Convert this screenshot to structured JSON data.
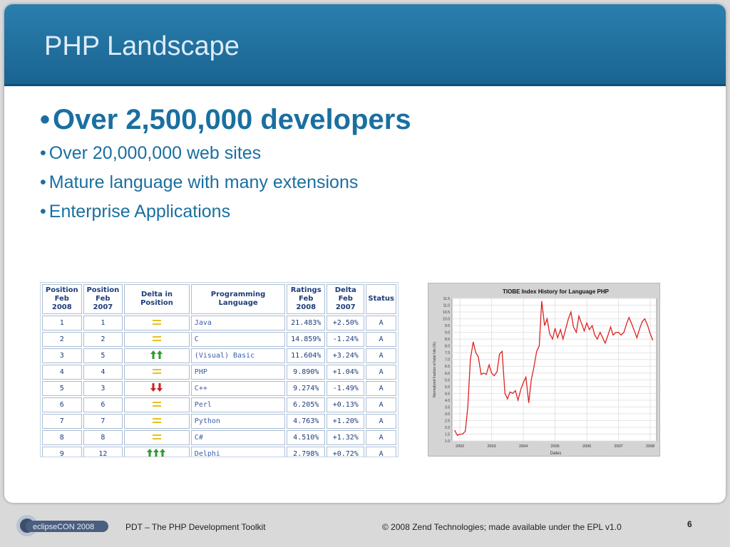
{
  "slide": {
    "title": "PHP Landscape",
    "bullets": [
      {
        "text": "Over 2,500,000 developers"
      },
      {
        "text": "Over 20,000,000 web sites"
      },
      {
        "text": "Mature language with many extensions"
      },
      {
        "text": "Enterprise Applications"
      }
    ]
  },
  "table": {
    "headers": {
      "pos2008": [
        "Position",
        "Feb 2008"
      ],
      "pos2007": [
        "Position",
        "Feb 2007"
      ],
      "delta_pos": "Delta in Position",
      "language": "Programming Language",
      "ratings": [
        "Ratings",
        "Feb 2008"
      ],
      "delta": [
        "Delta",
        "Feb 2007"
      ],
      "status": "Status"
    },
    "rows": [
      {
        "pos2008": "1",
        "pos2007": "1",
        "trend": "same",
        "language": "Java",
        "rating": "21.483%",
        "delta": "+2.50%",
        "status": "A"
      },
      {
        "pos2008": "2",
        "pos2007": "2",
        "trend": "same",
        "language": "C",
        "rating": "14.859%",
        "delta": "-1.24%",
        "status": "A"
      },
      {
        "pos2008": "3",
        "pos2007": "5",
        "trend": "up2",
        "language": "(Visual) Basic",
        "rating": "11.604%",
        "delta": "+3.24%",
        "status": "A"
      },
      {
        "pos2008": "4",
        "pos2007": "4",
        "trend": "same",
        "language": "PHP",
        "rating": "9.890%",
        "delta": "+1.04%",
        "status": "A"
      },
      {
        "pos2008": "5",
        "pos2007": "3",
        "trend": "down2",
        "language": "C++",
        "rating": "9.274%",
        "delta": "-1.49%",
        "status": "A"
      },
      {
        "pos2008": "6",
        "pos2007": "6",
        "trend": "same",
        "language": "Perl",
        "rating": "6.205%",
        "delta": "+0.13%",
        "status": "A"
      },
      {
        "pos2008": "7",
        "pos2007": "7",
        "trend": "same",
        "language": "Python",
        "rating": "4.763%",
        "delta": "+1.20%",
        "status": "A"
      },
      {
        "pos2008": "8",
        "pos2007": "8",
        "trend": "same",
        "language": "C#",
        "rating": "4.510%",
        "delta": "+1.32%",
        "status": "A"
      },
      {
        "pos2008": "9",
        "pos2007": "12",
        "trend": "up3",
        "language": "Delphi",
        "rating": "2.798%",
        "delta": "+0.72%",
        "status": "A"
      }
    ],
    "colors": {
      "same": "#e8c21a",
      "up": "#2e9b2e",
      "down": "#cc2020"
    }
  },
  "chart_data": {
    "type": "line",
    "title": "TIOBE Index History for Language PHP",
    "xlabel": "Dates",
    "ylabel": "Normalized fraction of total hits (%)",
    "xlim": [
      2001.75,
      2008.2
    ],
    "ylim": [
      1.0,
      11.5
    ],
    "x_ticks": [
      "2002",
      "2003",
      "2004",
      "2005",
      "2006",
      "2007",
      "2008"
    ],
    "y_ticks": [
      "11.5",
      "11.0",
      "10.5",
      "10.0",
      "9.5",
      "9.0",
      "8.5",
      "8.0",
      "7.5",
      "7.0",
      "6.5",
      "6.0",
      "5.5",
      "5.0",
      "4.5",
      "4.0",
      "3.5",
      "3.0",
      "2.5",
      "2.0",
      "1.5",
      "1.0"
    ],
    "grid": true,
    "line_color": "#e02020",
    "x": [
      2001.83,
      2001.92,
      2002.0,
      2002.08,
      2002.17,
      2002.25,
      2002.33,
      2002.42,
      2002.5,
      2002.58,
      2002.67,
      2002.75,
      2002.83,
      2002.92,
      2003.0,
      2003.08,
      2003.17,
      2003.25,
      2003.33,
      2003.42,
      2003.5,
      2003.58,
      2003.67,
      2003.75,
      2003.83,
      2003.92,
      2004.0,
      2004.08,
      2004.17,
      2004.25,
      2004.33,
      2004.42,
      2004.5,
      2004.58,
      2004.67,
      2004.75,
      2004.83,
      2004.92,
      2005.0,
      2005.08,
      2005.17,
      2005.25,
      2005.33,
      2005.42,
      2005.5,
      2005.58,
      2005.67,
      2005.75,
      2005.83,
      2005.92,
      2006.0,
      2006.08,
      2006.17,
      2006.25,
      2006.33,
      2006.42,
      2006.5,
      2006.58,
      2006.67,
      2006.75,
      2006.83,
      2006.92,
      2007.0,
      2007.08,
      2007.17,
      2007.25,
      2007.33,
      2007.42,
      2007.5,
      2007.58,
      2007.67,
      2007.75,
      2007.83,
      2007.92,
      2008.0,
      2008.08
    ],
    "y": [
      1.8,
      1.4,
      1.5,
      1.5,
      1.7,
      3.5,
      7.0,
      8.3,
      7.5,
      7.2,
      5.9,
      6.0,
      5.9,
      6.6,
      6.0,
      5.8,
      6.1,
      7.4,
      7.6,
      4.5,
      4.1,
      4.6,
      4.5,
      4.7,
      4.0,
      4.8,
      5.3,
      5.7,
      3.8,
      5.5,
      6.4,
      7.6,
      8.0,
      11.3,
      9.5,
      10.0,
      8.9,
      8.5,
      9.3,
      8.6,
      9.2,
      8.5,
      9.2,
      10.0,
      10.5,
      9.4,
      9.0,
      10.2,
      9.7,
      9.1,
      9.7,
      9.2,
      9.5,
      8.8,
      8.5,
      9.0,
      8.6,
      8.2,
      8.8,
      9.4,
      8.8,
      9.0,
      9.0,
      8.8,
      9.0,
      9.6,
      10.1,
      9.6,
      9.1,
      8.6,
      9.3,
      9.8,
      10.0,
      9.5,
      8.9,
      8.4
    ]
  },
  "footer": {
    "logo_text": "eclipseCON 2008",
    "left": "PDT – The PHP Development Toolkit",
    "right": "© 2008 Zend Technologies; made available under the EPL v1.0",
    "page": "6"
  }
}
